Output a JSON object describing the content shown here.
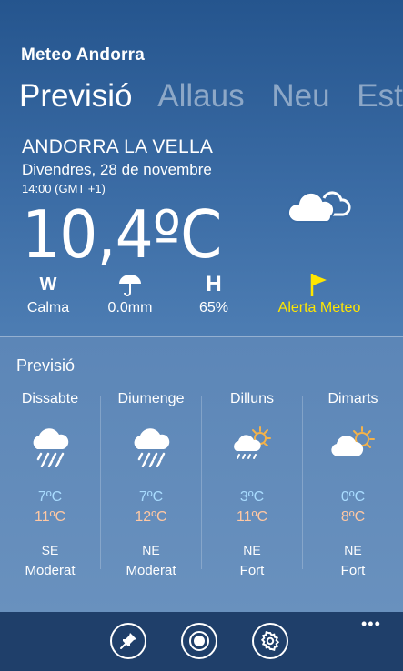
{
  "app": {
    "title": "Meteo Andorra"
  },
  "pivot": [
    "Previsió",
    "Allaus",
    "Neu",
    "Estac"
  ],
  "current": {
    "city": "ANDORRA LA VELLA",
    "date": "Divendres, 28 de novembre",
    "time": "14:00 (GMT +1)",
    "temperature": "10,4ºC",
    "icon": "cloudy-icon"
  },
  "stats": {
    "wind": {
      "symbol": "W",
      "label": "Calma",
      "icon": "wind-letter"
    },
    "rain": {
      "label": "0.0mm",
      "icon": "umbrella-icon"
    },
    "humidity": {
      "symbol": "H",
      "label": "65%",
      "icon": "humidity-letter"
    },
    "alert": {
      "label": "Alerta Meteo",
      "icon": "flag-icon",
      "color": "#ffe600"
    }
  },
  "forecast": {
    "title": "Previsió",
    "days": [
      {
        "name": "Dissabte",
        "icon": "rain-cloud-icon",
        "tmin": "7ºC",
        "tmax": "11ºC",
        "wind_dir": "SE",
        "wind_str": "Moderat"
      },
      {
        "name": "Diumenge",
        "icon": "rain-cloud-icon",
        "tmin": "7ºC",
        "tmax": "12ºC",
        "wind_dir": "NE",
        "wind_str": "Moderat"
      },
      {
        "name": "Dilluns",
        "icon": "sun-rain-cloud-icon",
        "tmin": "3ºC",
        "tmax": "11ºC",
        "wind_dir": "NE",
        "wind_str": "Fort"
      },
      {
        "name": "Dimarts",
        "icon": "sun-cloud-icon",
        "tmin": "0ºC",
        "tmax": "8ºC",
        "wind_dir": "NE",
        "wind_str": "Fort"
      }
    ]
  },
  "appbar": {
    "buttons": [
      "pin-icon",
      "record-icon",
      "settings-icon"
    ],
    "more": "•••"
  },
  "colors": {
    "min_temp": "#a9dcff",
    "max_temp": "#ffc8a3",
    "alert": "#ffe600"
  }
}
